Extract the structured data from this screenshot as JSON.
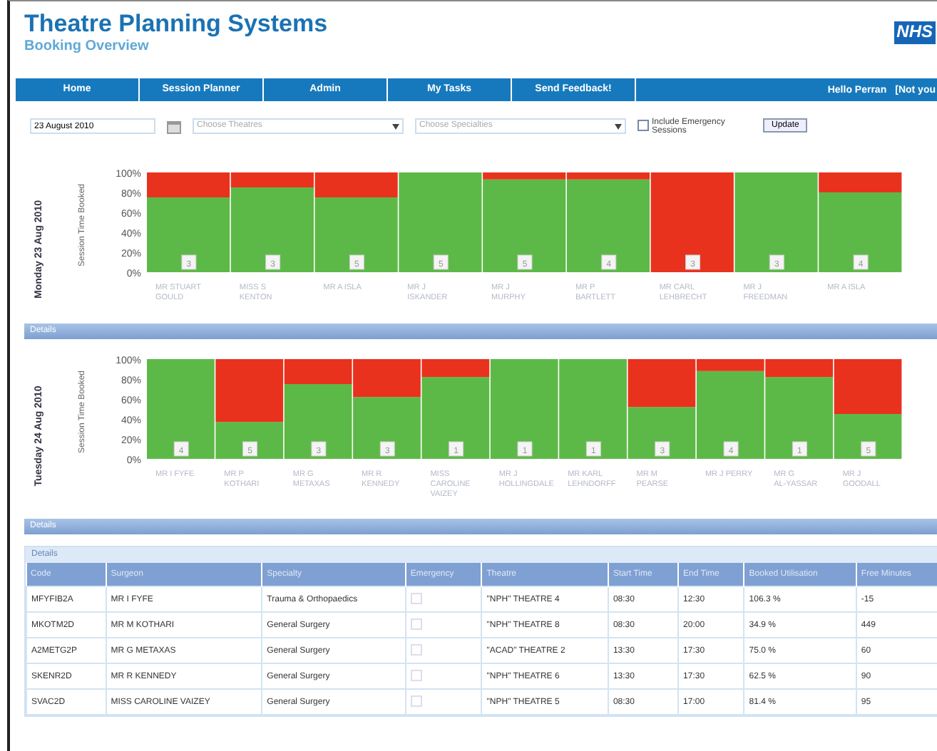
{
  "header": {
    "title": "Theatre Planning Systems",
    "subtitle": "Booking Overview",
    "logo": "NHS"
  },
  "nav": {
    "items": [
      {
        "label": "Home"
      },
      {
        "label": "Session Planner"
      },
      {
        "label": "Admin"
      },
      {
        "label": "My Tasks"
      },
      {
        "label": "Send Feedback!"
      }
    ],
    "user": "Hello Perran",
    "user_link": "[Not you"
  },
  "filters": {
    "date": "23 August 2010",
    "theatre_placeholder": "Choose Theatres",
    "specialty_placeholder": "Choose Specialties",
    "emergency_label": "Include Emergency Sessions",
    "emergency_checked": false,
    "button": "Update"
  },
  "days": [
    {
      "date_label": "Monday 23 Aug 2010",
      "details": "Details",
      "session_counts": [
        "3",
        "3",
        "5",
        "5",
        "5",
        "4",
        "3",
        "3",
        "4"
      ],
      "chart_data": {
        "type": "bar",
        "ylabel": "Session Time Booked",
        "stacked": true,
        "ylim": [
          0,
          100
        ],
        "yticks": [
          {
            "value": 0,
            "label": "0%"
          },
          {
            "value": 20,
            "label": "20%"
          },
          {
            "value": 40,
            "label": "40%"
          },
          {
            "value": 60,
            "label": "60%"
          },
          {
            "value": 80,
            "label": "80%"
          },
          {
            "value": 100,
            "label": "100%"
          }
        ],
        "categories": [
          "MR STUART GOULD",
          "MISS S KENTON",
          "MR A ISLA",
          "MR J ISKANDER",
          "MR J MURPHY",
          "MR P BARTLETT",
          "MR CARL LEHBRECHT",
          "MR J FREEDMAN",
          "MR A ISLA"
        ],
        "series": [
          {
            "color": "#5db947",
            "values": [
              75,
              85,
              75,
              100,
              93,
              93,
              0,
              100,
              80
            ]
          },
          {
            "color": "#e8321e",
            "values": [
              25,
              15,
              25,
              0,
              7,
              7,
              100,
              0,
              20
            ]
          }
        ]
      }
    },
    {
      "date_label": "Tuesday 24 Aug 2010",
      "details": "Details",
      "session_counts": [
        "4",
        "5",
        "3",
        "3",
        "1",
        "1",
        "1",
        "3",
        "4",
        "1",
        "5"
      ],
      "chart_data": {
        "type": "bar",
        "ylabel": "Session Time Booked",
        "stacked": true,
        "ylim": [
          0,
          100
        ],
        "yticks": [
          {
            "value": 0,
            "label": "0%"
          },
          {
            "value": 20,
            "label": "20%"
          },
          {
            "value": 40,
            "label": "40%"
          },
          {
            "value": 60,
            "label": "60%"
          },
          {
            "value": 80,
            "label": "80%"
          },
          {
            "value": 100,
            "label": "100%"
          }
        ],
        "categories": [
          "MR I FYFE",
          "MR P KOTHARI",
          "MR G METAXAS",
          "MR R KENNEDY",
          "MISS CAROLINE VAIZEY",
          "MR J HOLLINGDALE",
          "MR KARL LEHNDORFF",
          "MR M PEARSE",
          "MR J PERRY",
          "MR G AL-YASSAR",
          "MR J GOODALL"
        ],
        "series": [
          {
            "color": "#5db947",
            "values": [
              100,
              37,
              75,
              62,
              82,
              100,
              100,
              52,
              88,
              82,
              45
            ]
          },
          {
            "color": "#e8321e",
            "values": [
              0,
              63,
              25,
              38,
              18,
              0,
              0,
              48,
              12,
              18,
              55
            ]
          }
        ]
      }
    }
  ],
  "table": {
    "title": "Details",
    "columns": [
      "Code",
      "Surgeon",
      "Specialty",
      "Emergency",
      "Theatre",
      "Start Time",
      "End Time",
      "Booked Utilisation",
      "Free Minutes"
    ],
    "rows": [
      {
        "code": "MFYFIB2A",
        "surgeon": "MR I FYFE",
        "specialty": "Trauma & Orthopaedics",
        "emergency": false,
        "theatre": "\"NPH\" THEATRE 4",
        "start": "08:30",
        "end": "12:30",
        "utilisation": "106.3 %",
        "free": "-15"
      },
      {
        "code": "MKOTM2D",
        "surgeon": "MR M KOTHARI",
        "specialty": "General Surgery",
        "emergency": false,
        "theatre": "\"NPH\" THEATRE 8",
        "start": "08:30",
        "end": "20:00",
        "utilisation": "34.9 %",
        "free": "449"
      },
      {
        "code": "A2METG2P",
        "surgeon": "MR G METAXAS",
        "specialty": "General Surgery",
        "emergency": false,
        "theatre": "\"ACAD\" THEATRE 2",
        "start": "13:30",
        "end": "17:30",
        "utilisation": "75.0 %",
        "free": "60"
      },
      {
        "code": "SKENR2D",
        "surgeon": "MR R KENNEDY",
        "specialty": "General Surgery",
        "emergency": false,
        "theatre": "\"NPH\" THEATRE 6",
        "start": "13:30",
        "end": "17:30",
        "utilisation": "62.5 %",
        "free": "90"
      },
      {
        "code": "SVAC2D",
        "surgeon": "MISS CAROLINE VAIZEY",
        "specialty": "General Surgery",
        "emergency": false,
        "theatre": "\"NPH\" THEATRE 5",
        "start": "08:30",
        "end": "17:00",
        "utilisation": "81.4 %",
        "free": "95"
      }
    ]
  }
}
